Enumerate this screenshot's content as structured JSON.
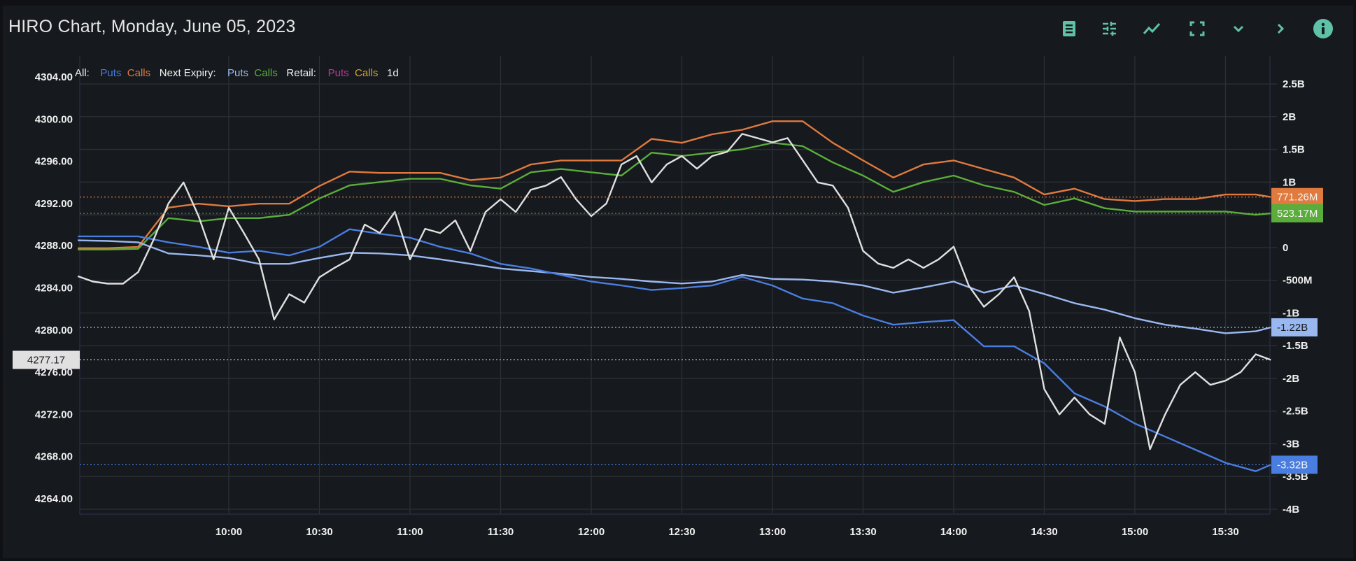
{
  "header": {
    "title": "HIRO Chart, Monday, June 05, 2023",
    "icons": [
      "table-icon",
      "settings-sliders-icon",
      "line-chart-icon",
      "fullscreen-icon",
      "chevron-down-icon",
      "chevron-right-icon",
      "info-icon"
    ]
  },
  "colors": {
    "accent": "#5fc1a8",
    "all_puts": "#4a7de0",
    "all_calls": "#e07a3e",
    "next_puts": "#9ab8f0",
    "next_calls": "#5aad3a",
    "retail_puts": "#c0359a",
    "retail_calls": "#d4a52c",
    "price": "#e0e0e0"
  },
  "chart_data": {
    "type": "line",
    "title": "HIRO Chart, Monday, June 05, 2023",
    "legend": {
      "placement": "top-left",
      "groups": [
        {
          "label": "All:",
          "items": [
            {
              "name": "Puts",
              "color_key": "all_puts"
            },
            {
              "name": "Calls",
              "color_key": "all_calls"
            }
          ]
        },
        {
          "label": "Next Expiry:",
          "items": [
            {
              "name": "Puts",
              "color_key": "next_puts"
            },
            {
              "name": "Calls",
              "color_key": "next_calls"
            }
          ]
        },
        {
          "label": "Retail:",
          "items": [
            {
              "name": "Puts",
              "color_key": "retail_puts"
            },
            {
              "name": "Calls",
              "color_key": "retail_calls"
            }
          ]
        }
      ],
      "period": "1d"
    },
    "x_ticks": [
      "10:00",
      "10:30",
      "11:00",
      "11:30",
      "12:00",
      "12:30",
      "13:00",
      "13:30",
      "14:00",
      "14:30",
      "15:00",
      "15:30"
    ],
    "xlim": [
      "09:11",
      "15:45"
    ],
    "left_axis": {
      "ylim": [
        4262,
        4306
      ],
      "ticks": [
        "4304.00",
        "4300.00",
        "4296.00",
        "4292.00",
        "4288.00",
        "4284.00",
        "4280.00",
        "4276.00",
        "4272.00",
        "4268.00",
        "4264.00"
      ]
    },
    "right_axis": {
      "ylim_billions": [
        -4.25,
        2.85
      ],
      "ticks": [
        {
          "v": 2.5,
          "t": "2.5B"
        },
        {
          "v": 2,
          "t": "2B"
        },
        {
          "v": 1.5,
          "t": "1.5B"
        },
        {
          "v": 1,
          "t": "1B"
        },
        {
          "v": 0.5,
          "t": ""
        },
        {
          "v": 0,
          "t": "0"
        },
        {
          "v": -0.5,
          "t": "-500M"
        },
        {
          "v": -1,
          "t": "-1B"
        },
        {
          "v": -1.5,
          "t": "-1.5B"
        },
        {
          "v": -2,
          "t": "-2B"
        },
        {
          "v": -2.5,
          "t": "-2.5B"
        },
        {
          "v": -3,
          "t": "-3B"
        },
        {
          "v": -3.5,
          "t": "-3.5B"
        },
        {
          "v": -4,
          "t": "-4B"
        }
      ]
    },
    "price": {
      "name": "Price",
      "axis": "left",
      "start": "09:10",
      "step_min": 5,
      "values": [
        4285.1,
        4284.6,
        4284.4,
        4284.4,
        4285.5,
        4288.5,
        4292,
        4294,
        4290.8,
        4286.7,
        4291.6,
        4289.2,
        4286.7,
        4281,
        4283.4,
        4282.6,
        4285,
        4285.9,
        4286.7,
        4290,
        4289.2,
        4291.2,
        4286.7,
        4289.6,
        4289.2,
        4290.4,
        4287.5,
        4291.2,
        4292.4,
        4291.2,
        4293.3,
        4293.7,
        4294.5,
        4292.4,
        4290.8,
        4292,
        4295.7,
        4296.5,
        4294,
        4295.7,
        4296.5,
        4295.3,
        4296.5,
        4296.9,
        4298.6,
        4298.2,
        4297.8,
        4298.2,
        4296.1,
        4294,
        4293.7,
        4291.6,
        4287.5,
        4286.3,
        4285.9,
        4286.7,
        4285.9,
        4286.7,
        4287.9,
        4284.2,
        4282.2,
        4283.4,
        4285,
        4281.8,
        4274.4,
        4272,
        4273.6,
        4272,
        4271.1,
        4279.3,
        4276,
        4268.7,
        4272,
        4274.8,
        4276,
        4274.8,
        4275.2,
        4276,
        4277.7,
        4277.17
      ],
      "last_label": "4277.17"
    },
    "series_times": [
      "09:10",
      "09:20",
      "09:30",
      "09:40",
      "09:50",
      "10:00",
      "10:10",
      "10:20",
      "10:30",
      "10:40",
      "10:50",
      "11:00",
      "11:10",
      "11:20",
      "11:30",
      "11:40",
      "11:50",
      "12:00",
      "12:10",
      "12:20",
      "12:30",
      "12:40",
      "12:50",
      "13:00",
      "13:10",
      "13:20",
      "13:30",
      "13:40",
      "13:50",
      "14:00",
      "14:10",
      "14:20",
      "14:30",
      "14:40",
      "14:50",
      "15:00",
      "15:10",
      "15:20",
      "15:30",
      "15:40",
      "15:45"
    ],
    "series": [
      {
        "name": "All Calls",
        "color_key": "all_calls",
        "unit": "B",
        "last_label": "771.26M",
        "values": [
          -0.01,
          -0.01,
          0.01,
          0.61,
          0.67,
          0.63,
          0.67,
          0.67,
          0.94,
          1.16,
          1.14,
          1.14,
          1.14,
          1.03,
          1.07,
          1.27,
          1.33,
          1.33,
          1.33,
          1.66,
          1.6,
          1.73,
          1.8,
          1.93,
          1.93,
          1.6,
          1.33,
          1.07,
          1.27,
          1.33,
          1.2,
          1.07,
          0.81,
          0.9,
          0.74,
          0.71,
          0.74,
          0.74,
          0.81,
          0.81,
          0.771
        ]
      },
      {
        "name": "Next Expiry Calls",
        "color_key": "next_calls",
        "unit": "B",
        "last_label": "523.17M",
        "values": [
          -0.03,
          -0.03,
          -0.02,
          0.45,
          0.4,
          0.45,
          0.45,
          0.5,
          0.75,
          0.95,
          1.0,
          1.05,
          1.05,
          0.95,
          0.9,
          1.15,
          1.2,
          1.15,
          1.1,
          1.45,
          1.4,
          1.45,
          1.5,
          1.6,
          1.55,
          1.3,
          1.1,
          0.85,
          1.0,
          1.1,
          0.95,
          0.85,
          0.65,
          0.75,
          0.6,
          0.55,
          0.55,
          0.55,
          0.55,
          0.5,
          0.523
        ]
      },
      {
        "name": "Next Expiry Puts",
        "color_key": "next_puts",
        "unit": "B",
        "last_label": "-1.22B",
        "label_text_dark": true,
        "values": [
          0.11,
          0.1,
          0.08,
          -0.09,
          -0.12,
          -0.16,
          -0.25,
          -0.25,
          -0.16,
          -0.08,
          -0.09,
          -0.12,
          -0.18,
          -0.25,
          -0.32,
          -0.36,
          -0.4,
          -0.45,
          -0.48,
          -0.52,
          -0.55,
          -0.52,
          -0.42,
          -0.48,
          -0.49,
          -0.52,
          -0.58,
          -0.69,
          -0.61,
          -0.52,
          -0.69,
          -0.58,
          -0.71,
          -0.85,
          -0.95,
          -1.08,
          -1.18,
          -1.24,
          -1.31,
          -1.28,
          -1.22
        ]
      },
      {
        "name": "All Puts",
        "color_key": "all_puts",
        "unit": "B",
        "last_label": "-3.32B",
        "values": [
          0.17,
          0.17,
          0.17,
          0.08,
          0.01,
          -0.08,
          -0.05,
          -0.12,
          0.01,
          0.28,
          0.21,
          0.15,
          0.01,
          -0.09,
          -0.25,
          -0.32,
          -0.42,
          -0.52,
          -0.58,
          -0.65,
          -0.62,
          -0.58,
          -0.45,
          -0.58,
          -0.78,
          -0.85,
          -1.04,
          -1.18,
          -1.14,
          -1.11,
          -1.51,
          -1.51,
          -1.77,
          -2.23,
          -2.43,
          -2.69,
          -2.89,
          -3.09,
          -3.29,
          -3.42,
          -3.32
        ]
      }
    ]
  }
}
